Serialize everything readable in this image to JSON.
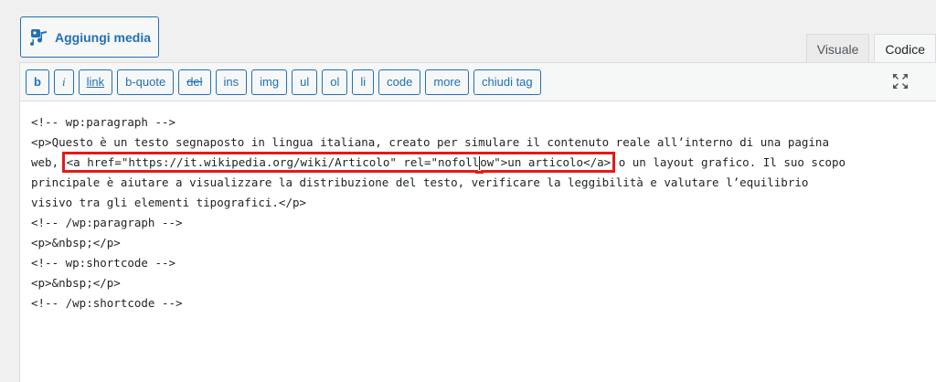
{
  "media": {
    "add_label": "Aggiungi media"
  },
  "tabs": [
    {
      "label": "Visuale",
      "active": false
    },
    {
      "label": "Codice",
      "active": true
    }
  ],
  "toolbar": {
    "buttons": [
      "b",
      "i",
      "link",
      "b-quote",
      "del",
      "ins",
      "img",
      "ul",
      "ol",
      "li",
      "code",
      "more",
      "chiudi tag"
    ]
  },
  "editor": {
    "lines": [
      "<!-- wp:paragraph -->",
      "<p>Questo è un testo segnaposto in lingua italiana, creato per simulare il contenuto reale all’interno di una pagina",
      "",
      "principale è aiutare a visualizzare la distribuzione del testo, verificare la leggibilità e valutare l’equilibrio",
      "visivo tra gli elementi tipografici.</p>",
      "<!-- /wp:paragraph -->",
      "<p>&nbsp;</p>",
      "<!-- wp:shortcode -->",
      "<p>&nbsp;</p>",
      "<!-- /wp:shortcode -->"
    ],
    "line3_pre": "web, ",
    "highlight_part1": "<a href=\"https://it.wikipedia.org/wiki/Articolo\" rel=\"nofoll",
    "highlight_part2": "ow\">un articolo</a>",
    "line3_post": " o un layout grafico. Il suo scopo"
  },
  "colors": {
    "accent": "#2271b1",
    "highlight": "#e11b1b"
  }
}
